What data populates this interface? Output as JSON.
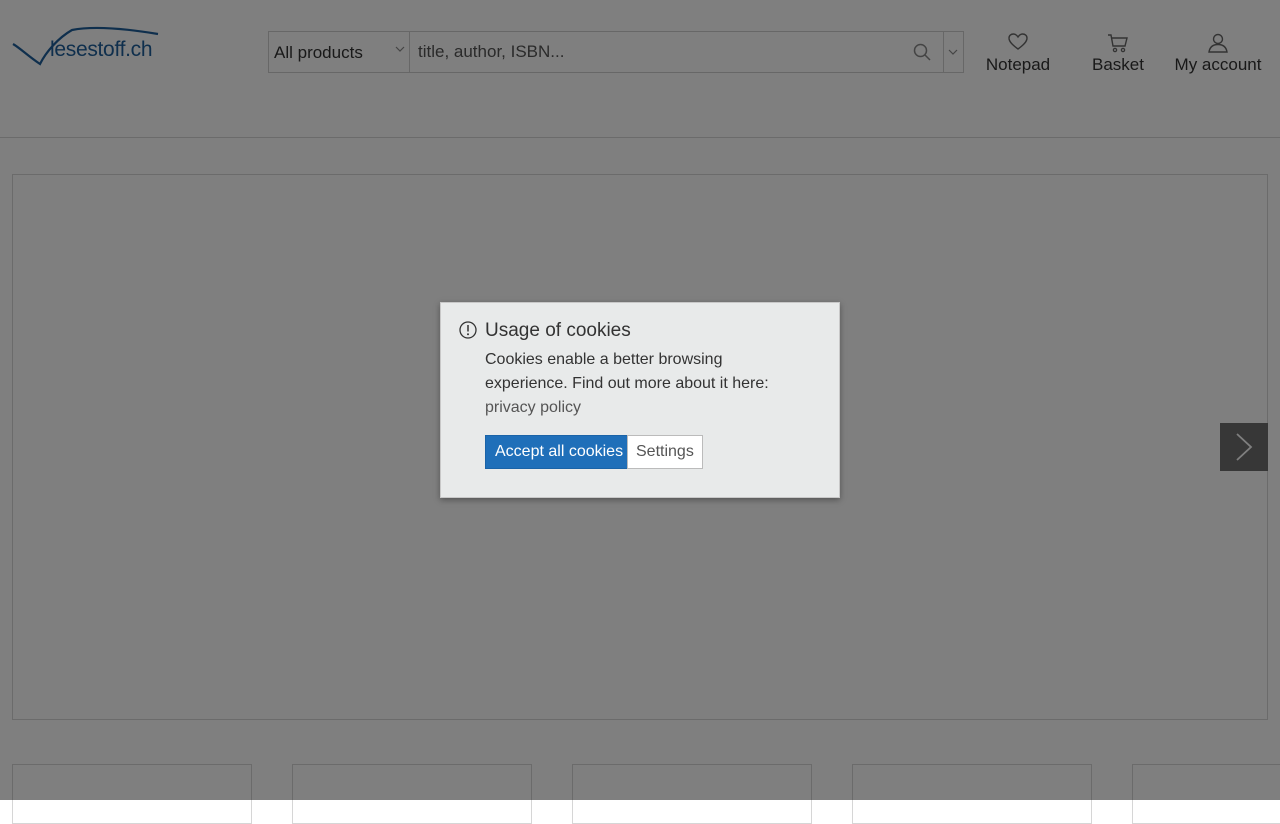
{
  "header": {
    "logo_text": "lesestoff.ch",
    "search": {
      "category": "All products",
      "placeholder": "title, author, ISBN..."
    },
    "nav": {
      "notepad": "Notepad",
      "basket": "Basket",
      "account": "My account"
    }
  },
  "cookie_dialog": {
    "title": "Usage of cookies",
    "text": "Cookies enable a better browsing experience. Find out more about it here:",
    "link": "privacy policy",
    "accept_label": "Accept all cookies",
    "settings_label": "Settings"
  },
  "icons": {
    "search": "search-icon",
    "notepad": "heart-icon",
    "basket": "cart-icon",
    "account": "user-icon",
    "slider_next": "chevron-right-icon",
    "notice": "exclamation-circle-icon"
  },
  "colors": {
    "brand": "#1f5f9a",
    "accept_button": "#1f6fb9",
    "overlay": "rgba(0,0,0,0.5)"
  }
}
